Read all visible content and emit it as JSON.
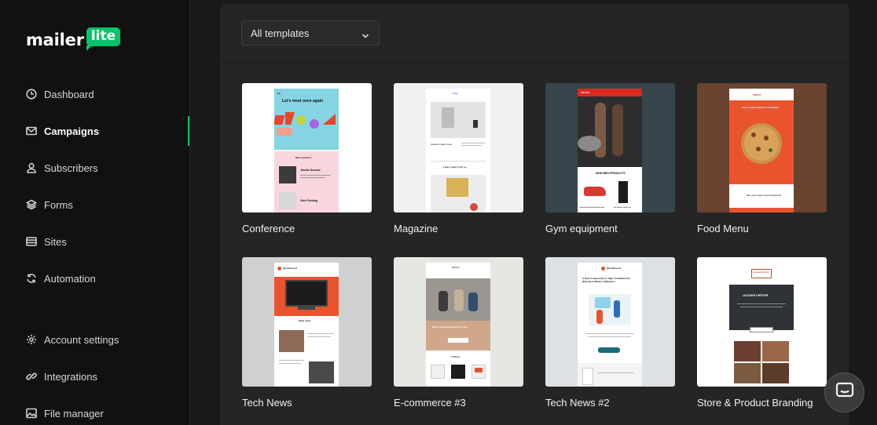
{
  "brand": {
    "word": "mailer",
    "badge": "lite",
    "accent": "#09c269"
  },
  "sidebar": {
    "items": [
      {
        "label": "Dashboard",
        "icon": "clock-icon"
      },
      {
        "label": "Campaigns",
        "icon": "envelope-icon",
        "active": true
      },
      {
        "label": "Subscribers",
        "icon": "user-icon"
      },
      {
        "label": "Forms",
        "icon": "layers-icon"
      },
      {
        "label": "Sites",
        "icon": "browser-icon"
      },
      {
        "label": "Automation",
        "icon": "refresh-icon"
      },
      {
        "label": "Account settings",
        "icon": "gear-icon"
      },
      {
        "label": "Integrations",
        "icon": "link-icon"
      },
      {
        "label": "File manager",
        "icon": "image-icon"
      }
    ]
  },
  "filter": {
    "selected": "All templates"
  },
  "templates": [
    {
      "name": "Conference",
      "heading": "Let's meet once again",
      "sub": "Meet speakers",
      "speaker1": "Janelle Sonirae",
      "speaker2": "Seth Fielding",
      "logo": "fig"
    },
    {
      "name": "Magazine",
      "logo": "blog",
      "caption": "Latest reads from us",
      "article": "Autumn's paper issue"
    },
    {
      "name": "Gym equipment",
      "logo": "FITLIFE",
      "headline": "NEW MEN PRODUCTS",
      "item1": "Lightweight & Breathable Sneaker",
      "item2": "Best Motion Guide Top"
    },
    {
      "name": "Food Menu",
      "logo": "FROOT",
      "headline": "Your weekly dinners is available!",
      "footer": "We serve tasty food and drinks"
    },
    {
      "name": "Tech News",
      "logo": "QuickSound",
      "headline": "Daily news"
    },
    {
      "name": "E-commerce #3",
      "logo": "Afresh",
      "headline": "Want a musical-led products for free",
      "section": "T-Shirts"
    },
    {
      "name": "Tech News #2",
      "logo": "QuickSound",
      "headline": "A New Components to Help You Build Your Website in Matter of Minutes!"
    },
    {
      "name": "Store & Product Branding",
      "logo": "LEATHER HIPSTER",
      "headline": "LEATHER HIPSTER"
    }
  ],
  "chat": {
    "icon": "chat-icon"
  }
}
